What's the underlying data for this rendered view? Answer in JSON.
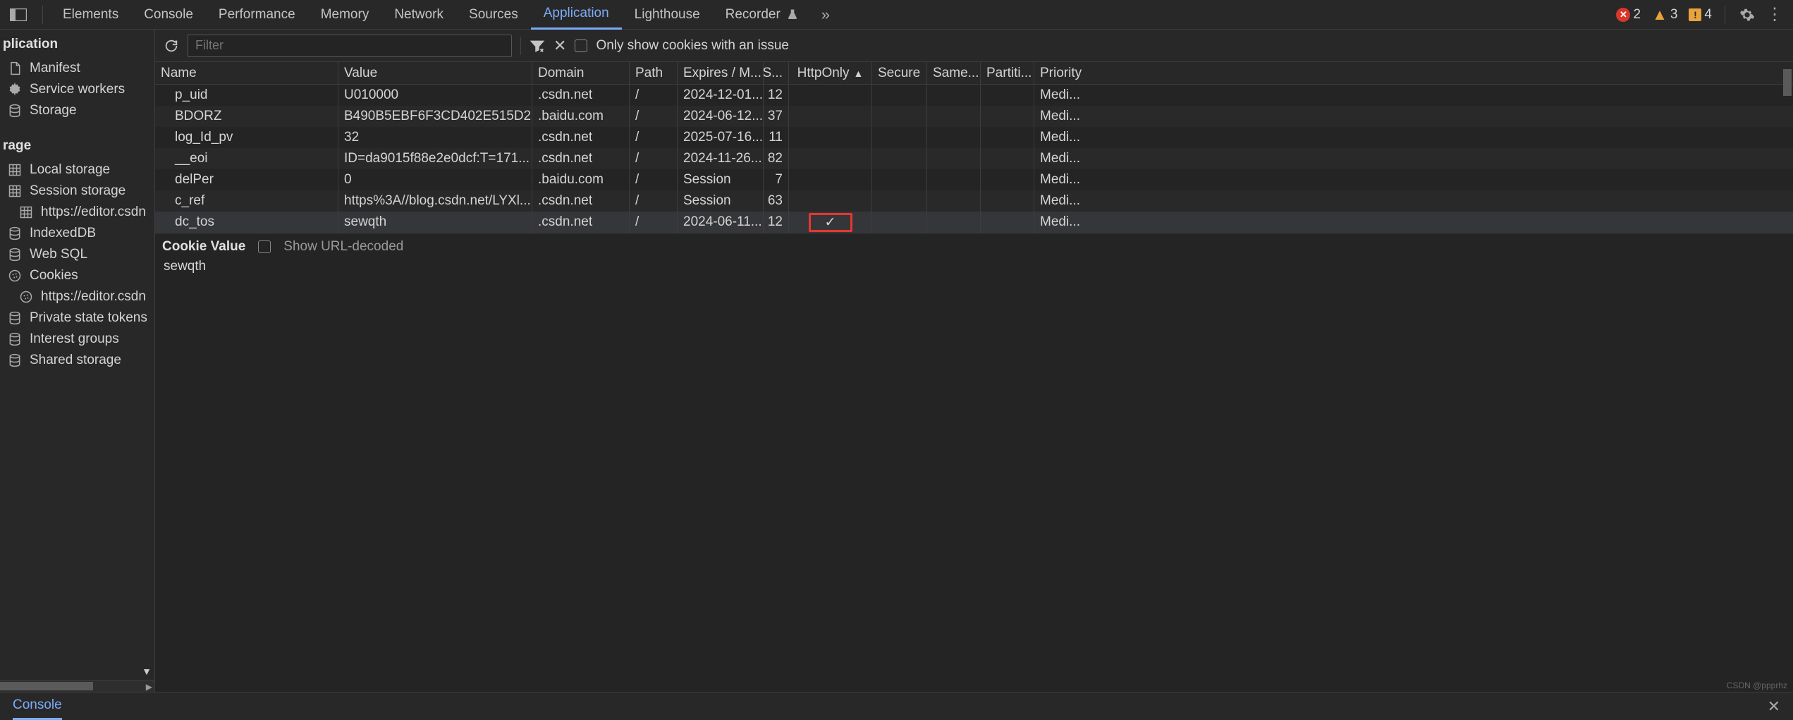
{
  "tabs": {
    "items": [
      "Elements",
      "Console",
      "Performance",
      "Memory",
      "Network",
      "Sources",
      "Application",
      "Lighthouse",
      "Recorder"
    ],
    "active": "Application"
  },
  "issues": {
    "errors": "2",
    "warnings": "3",
    "info": "4"
  },
  "sidebar": {
    "section_app": "plication",
    "app_items": [
      {
        "icon": "file",
        "label": "Manifest"
      },
      {
        "icon": "gear",
        "label": "Service workers"
      },
      {
        "icon": "db",
        "label": "Storage"
      }
    ],
    "section_storage": "rage",
    "storage_items": [
      {
        "icon": "grid",
        "label": "Local storage",
        "indent": false
      },
      {
        "icon": "grid",
        "label": "Session storage",
        "indent": false
      },
      {
        "icon": "grid",
        "label": "https://editor.csdn",
        "indent": true
      },
      {
        "icon": "db",
        "label": "IndexedDB",
        "indent": false
      },
      {
        "icon": "db",
        "label": "Web SQL",
        "indent": false
      },
      {
        "icon": "cookie",
        "label": "Cookies",
        "indent": false
      },
      {
        "icon": "cookie",
        "label": "https://editor.csdn",
        "indent": true
      },
      {
        "icon": "db",
        "label": "Private state tokens",
        "indent": false
      },
      {
        "icon": "db",
        "label": "Interest groups",
        "indent": false
      },
      {
        "icon": "db",
        "label": "Shared storage",
        "indent": false
      }
    ]
  },
  "toolbar": {
    "filter_placeholder": "Filter",
    "only_issues": "Only show cookies with an issue"
  },
  "table": {
    "headers": {
      "name": "Name",
      "value": "Value",
      "domain": "Domain",
      "path": "Path",
      "expires": "Expires / M...",
      "size": "S...",
      "httponly": "HttpOnly",
      "secure": "Secure",
      "samesite": "Same...",
      "partition": "Partiti...",
      "priority": "Priority"
    },
    "sort_col": "httponly",
    "rows": [
      {
        "name": "p_uid",
        "value": "U010000",
        "domain": ".csdn.net",
        "path": "/",
        "expires": "2024-12-01...",
        "size": "12",
        "httponly": "",
        "priority": "Medi..."
      },
      {
        "name": "BDORZ",
        "value": "B490B5EBF6F3CD402E515D2...",
        "domain": ".baidu.com",
        "path": "/",
        "expires": "2024-06-12...",
        "size": "37",
        "httponly": "",
        "priority": "Medi..."
      },
      {
        "name": "log_Id_pv",
        "value": "32",
        "domain": ".csdn.net",
        "path": "/",
        "expires": "2025-07-16...",
        "size": "11",
        "httponly": "",
        "priority": "Medi..."
      },
      {
        "name": "__eoi",
        "value": "ID=da9015f88e2e0dcf:T=171...",
        "domain": ".csdn.net",
        "path": "/",
        "expires": "2024-11-26...",
        "size": "82",
        "httponly": "",
        "priority": "Medi..."
      },
      {
        "name": "delPer",
        "value": "0",
        "domain": ".baidu.com",
        "path": "/",
        "expires": "Session",
        "size": "7",
        "httponly": "",
        "priority": "Medi..."
      },
      {
        "name": "c_ref",
        "value": "https%3A//blog.csdn.net/LYXl...",
        "domain": ".csdn.net",
        "path": "/",
        "expires": "Session",
        "size": "63",
        "httponly": "",
        "priority": "Medi..."
      },
      {
        "name": "dc_tos",
        "value": "sewqth",
        "domain": ".csdn.net",
        "path": "/",
        "expires": "2024-06-11...",
        "size": "12",
        "httponly": "✓",
        "priority": "Medi...",
        "selected": true,
        "highlight": true
      }
    ]
  },
  "detail": {
    "title": "Cookie Value",
    "checkbox_label": "Show URL-decoded",
    "value": "sewqth"
  },
  "drawer": {
    "tab": "Console"
  },
  "watermark": "CSDN @ppprhz"
}
